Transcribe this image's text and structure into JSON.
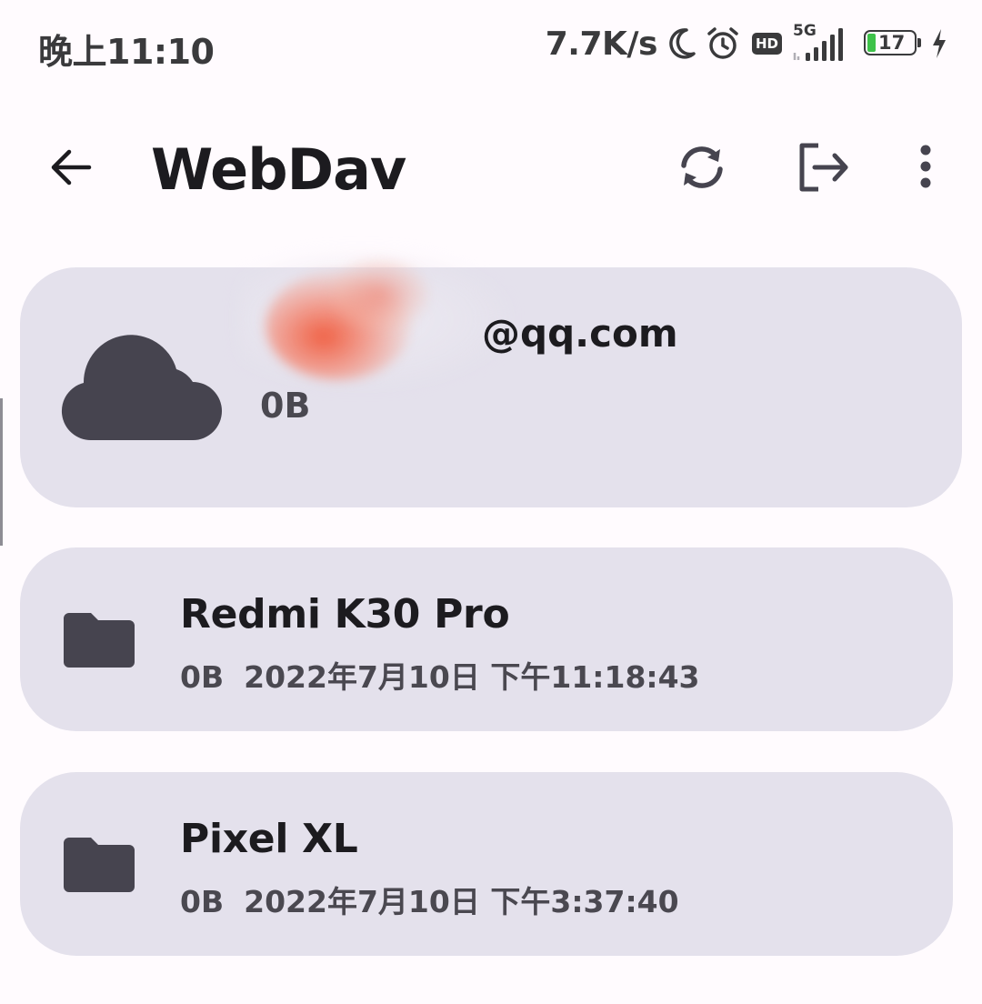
{
  "status_bar": {
    "time": "晚上11:10",
    "net_speed": "7.7K/s",
    "network_type": "5G",
    "hd_label": "HD",
    "battery_level": "17",
    "icons": [
      "moon-icon",
      "alarm-icon",
      "hd-icon",
      "signal-icon",
      "battery-icon",
      "charging-icon"
    ]
  },
  "app_bar": {
    "title": "WebDav",
    "icons": [
      "back-arrow-icon",
      "sync-icon",
      "logout-icon",
      "more-vert-icon"
    ]
  },
  "account": {
    "email_suffix": "@qq.com",
    "size": "0B",
    "icon": "cloud-icon"
  },
  "folders": [
    {
      "name": "Redmi K30 Pro",
      "size": "0B",
      "date": "2022年7月10日",
      "time": "下午11:18:43",
      "icon": "folder-icon"
    },
    {
      "name": "Pixel XL",
      "size": "0B",
      "date": "2022年7月10日",
      "time": "下午3:37:40",
      "icon": "folder-icon"
    }
  ],
  "colors": {
    "background": "#fffbfe",
    "card": "#e4e1ec",
    "icon_dark": "#46444f",
    "battery_green": "#3ec24a"
  }
}
